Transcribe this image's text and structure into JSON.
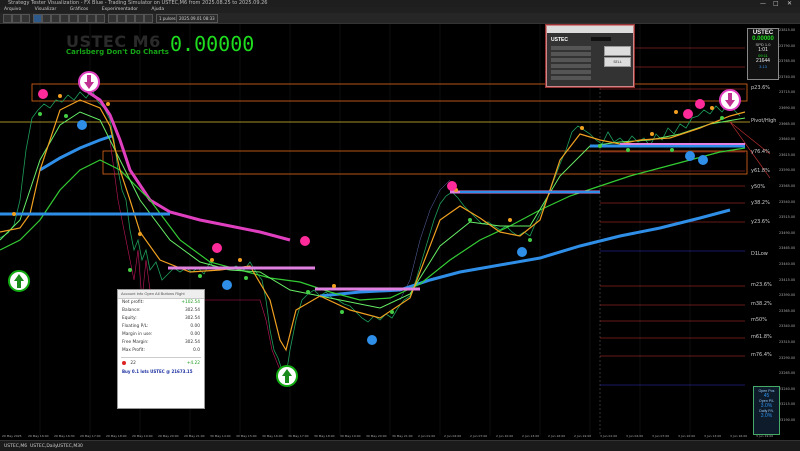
{
  "window": {
    "title": "Strategy Tester Visualization - FX Blue - Trading Simulator on USTEC,M6 from 2025.08.25 to 2025.09.26",
    "controls": [
      "—",
      "□",
      "✕"
    ]
  },
  "menu": [
    "Arquivo",
    "Visualizar",
    "Gráficos",
    "Experimentador",
    "Ajuda"
  ],
  "toolbar": {
    "speed_label": "1 pulses",
    "date_label": "2025.09.01 08:33"
  },
  "chart": {
    "symbol_watermark": "USTEC M6",
    "subtitle": "Carlsberg Don't Do Charts",
    "big_value": "0.00000",
    "fib_labels": {
      "p236": "p23.6%",
      "r_pivot": "Pivot/High",
      "y764": "y76.4%",
      "y618": "y61.8%",
      "y50": "y50%",
      "y382": "y38.2%",
      "y236": "y23.6%",
      "d1low": "D1Low",
      "m236": "m23.6%",
      "m382": "m38.2%",
      "m50": "m50%",
      "m618": "m61.8%",
      "m764": "m76.4%"
    },
    "price_axis": [
      "23815.00",
      "23790.00",
      "23765.00",
      "23740.00",
      "23715.00",
      "23690.00",
      "23665.00",
      "23640.00",
      "23615.00",
      "23590.00",
      "23565.00",
      "23540.00",
      "23515.00",
      "23490.00",
      "23465.00",
      "23440.00",
      "23415.00",
      "23390.00",
      "23365.00",
      "23340.00",
      "23315.00",
      "23290.00",
      "23265.00",
      "23240.00",
      "23215.00",
      "23190.00"
    ],
    "time_axis": [
      "29 May 2025",
      "29 May 16:00",
      "29 May 16:30",
      "29 May 17:00",
      "29 May 18:00",
      "29 May 19:00",
      "29 May 20:00",
      "29 May 21:00",
      "30 May 14:00",
      "30 May 15:00",
      "30 May 16:00",
      "30 May 17:00",
      "30 May 18:00",
      "30 May 19:00",
      "30 May 20:00",
      "30 May 21:00",
      "2 Jun 01:00",
      "2 Jun 04:00",
      "2 Jun 07:00",
      "2 Jun 10:00",
      "2 Jun 13:00",
      "2 Jun 16:00",
      "2 Jun 19:00",
      "3 Jun 01:00",
      "3 Jun 04:00",
      "3 Jun 07:00",
      "3 Jun 10:00",
      "3 Jun 13:00",
      "3 Jun 16:00",
      "3 Jun 19:00"
    ]
  },
  "top_right_box": {
    "symbol": "USTEC",
    "value": "0.00000",
    "spread_label": "SPD 1.0",
    "timer": "1:01",
    "sub": "09:11",
    "price": "21644",
    "extra": "3.13"
  },
  "bottom_right_box": {
    "open_pos_label": "Open Pos",
    "open_pos_value": "45",
    "open_pl_label": "Open P/L",
    "open_pl_value": "3.0%",
    "daily_pl_label": "Daily P/L",
    "daily_pl_value": "3.0%"
  },
  "order_dialog": {
    "symbol": "USTEC",
    "rows": [
      "Lots",
      "Stop",
      "Take",
      "Comment",
      "Expiry",
      "Magic"
    ],
    "button": "SELL"
  },
  "account": {
    "header": "Account Info    Open All Buttons Right",
    "rows": [
      {
        "label": "Net profit:",
        "value": "+102.54"
      },
      {
        "label": "Balance:",
        "value": "302.54"
      },
      {
        "label": "Equity:",
        "value": "302.54"
      },
      {
        "label": "Floating P/L:",
        "value": "0.00"
      },
      {
        "label": "Margin in use:",
        "value": "0.00"
      },
      {
        "label": "Free Margin:",
        "value": "302.54"
      },
      {
        "label": "Max Profit:",
        "value": "0.0"
      }
    ],
    "trade_id": "22",
    "trade_pl": "+4.22",
    "trade_text": "Buy 0.1 lots USTEC @ 21673.15"
  },
  "tabs": [
    "USTEC,M6",
    "USTEC,Daily",
    "USTEC,M30"
  ],
  "colors": {
    "accent": "#1fdc1f",
    "fib_box": "#e06a1a",
    "magenta": "#e040c0",
    "blue": "#2f8fe8",
    "orange": "#f0a020"
  }
}
